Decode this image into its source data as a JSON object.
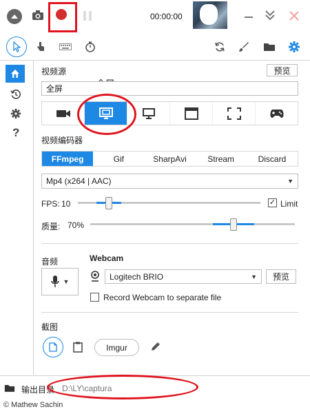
{
  "top": {
    "timer": "00:00:00",
    "icons": [
      "collapse-icon",
      "camera-icon",
      "record-icon",
      "pause-icon",
      "minimize-icon",
      "close-icon"
    ]
  },
  "tools": {
    "icons": [
      "pointer-icon",
      "click-hand-icon",
      "keyboard-icon",
      "timer-icon",
      "refresh-icon",
      "brush-icon",
      "folder-icon",
      "settings-icon"
    ]
  },
  "sidebar": {
    "icons": [
      "home-icon",
      "history-icon",
      "settings-icon",
      "help-icon"
    ],
    "help_label": "?"
  },
  "video_source": {
    "title": "视频源",
    "preview_label": "预览",
    "selected_value": "全屏",
    "annotation": "全屏",
    "sources": [
      "webcam-icon",
      "fullscreen-icon",
      "monitor-icon",
      "window-icon",
      "region-icon",
      "gamepad-icon"
    ],
    "active_index": 1
  },
  "encoder": {
    "title": "视频编码器",
    "tabs": [
      "FFmpeg",
      "Gif",
      "SharpAvi",
      "Stream",
      "Discard"
    ],
    "active_tab": 0,
    "codec": "Mp4 (x264 | AAC)",
    "fps_label": "FPS:",
    "fps_value": "10",
    "fps_level": 0.17,
    "limit_label": "Limit",
    "limit_checked": true,
    "quality_label": "质量:",
    "quality_value": "70%",
    "quality_level": 0.7
  },
  "audio": {
    "title": "音频"
  },
  "webcam": {
    "title": "Webcam",
    "device": "Logitech BRIO",
    "preview_label": "预览",
    "separate_label": "Record Webcam to separate file"
  },
  "screenshot": {
    "title": "截图",
    "imgur_label": "Imgur"
  },
  "footer": {
    "output_label": "输出目录",
    "output_path": "D:\\LY\\captura",
    "copyright": "© Mathew Sachin"
  },
  "colors": {
    "accent": "#1e88e5",
    "record": "#d32f2f",
    "annotation": "#e0141e"
  }
}
